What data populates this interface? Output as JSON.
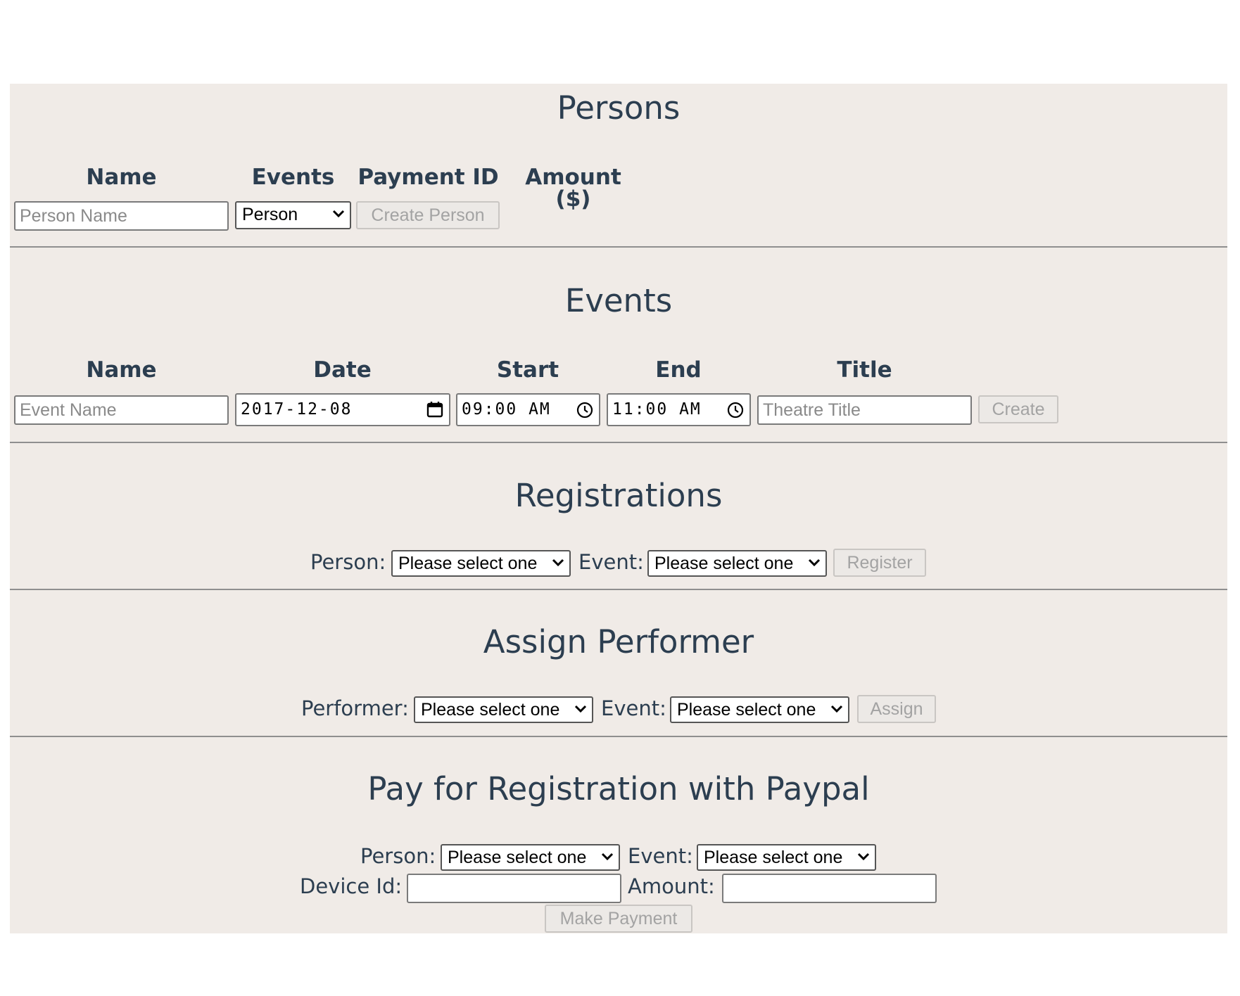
{
  "persons": {
    "title": "Persons",
    "headers": {
      "name": "Name",
      "events": "Events",
      "payment_id": "Payment ID",
      "amount": "Amount ($)"
    },
    "name_placeholder": "Person Name",
    "type_select": "Person",
    "create_button": "Create Person"
  },
  "events": {
    "title": "Events",
    "headers": {
      "name": "Name",
      "date": "Date",
      "start": "Start",
      "end": "End",
      "title": "Title"
    },
    "name_placeholder": "Event Name",
    "date_value": "2017-12-08",
    "start_value": "09:00 AM",
    "end_value": "11:00 AM",
    "title_placeholder": "Theatre Title",
    "create_button": "Create"
  },
  "registrations": {
    "title": "Registrations",
    "person_label": "Person:",
    "person_select": "Please select one",
    "event_label": "Event:",
    "event_select": "Please select one",
    "register_button": "Register"
  },
  "assign": {
    "title": "Assign Performer",
    "performer_label": "Performer:",
    "performer_select": "Please select one",
    "event_label": "Event:",
    "event_select": "Please select one",
    "assign_button": "Assign"
  },
  "payment": {
    "title": "Pay for Registration with Paypal",
    "person_label": "Person:",
    "person_select": "Please select one",
    "event_label": "Event:",
    "event_select": "Please select one",
    "device_label": "Device Id:",
    "device_value": "",
    "amount_label": "Amount:",
    "amount_value": "",
    "pay_button": "Make Payment"
  },
  "colors": {
    "panel_bg": "#f0ebe7",
    "text": "#2c3e50",
    "divider": "#8f8f8f",
    "disabled_text": "#a3a3a3"
  },
  "icons": [
    "chevron-down-icon",
    "calendar-icon",
    "clock-icon"
  ]
}
